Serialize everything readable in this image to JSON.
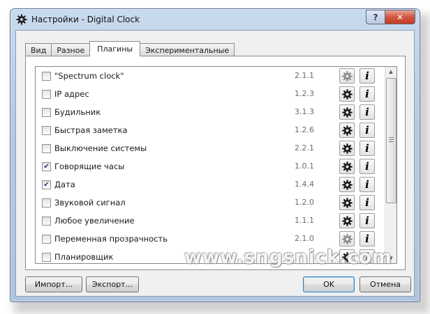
{
  "window": {
    "title": "Настройки - Digital Clock",
    "help_label": "?",
    "close_label": "✕"
  },
  "tabs": [
    {
      "label": "Вид",
      "active": false
    },
    {
      "label": "Разное",
      "active": false
    },
    {
      "label": "Плагины",
      "active": true
    },
    {
      "label": "Экспериментальные",
      "active": false
    }
  ],
  "plugins": [
    {
      "name": "\"Spectrum clock\"",
      "version": "2.1.1",
      "checked": false,
      "settings_enabled": false
    },
    {
      "name": "IP адрес",
      "version": "1.2.3",
      "checked": false,
      "settings_enabled": true
    },
    {
      "name": "Будильник",
      "version": "3.1.3",
      "checked": false,
      "settings_enabled": true
    },
    {
      "name": "Быстрая заметка",
      "version": "1.2.6",
      "checked": false,
      "settings_enabled": true
    },
    {
      "name": "Выключение системы",
      "version": "2.2.1",
      "checked": false,
      "settings_enabled": true
    },
    {
      "name": "Говорящие часы",
      "version": "1.0.1",
      "checked": true,
      "settings_enabled": true
    },
    {
      "name": "Дата",
      "version": "1.4.4",
      "checked": true,
      "settings_enabled": true
    },
    {
      "name": "Звуковой сигнал",
      "version": "1.2.0",
      "checked": false,
      "settings_enabled": true
    },
    {
      "name": "Любое увеличение",
      "version": "1.1.1",
      "checked": false,
      "settings_enabled": true
    },
    {
      "name": "Переменная прозрачность",
      "version": "2.1.0",
      "checked": false,
      "settings_enabled": false
    },
    {
      "name": "Планировщик",
      "version": "",
      "checked": false,
      "settings_enabled": true
    }
  ],
  "info_label": "i",
  "icons": {
    "settings": "gear-icon",
    "info": "info-icon"
  },
  "buttons": {
    "import": "Импорт...",
    "export": "Экспорт...",
    "ok": "OK",
    "cancel": "Отмена"
  },
  "watermark": "www.sngsnick.com",
  "colors": {
    "gear_enabled": "#1a1a1a",
    "gear_disabled": "#8a8a8a",
    "check": "#1e3f73"
  }
}
